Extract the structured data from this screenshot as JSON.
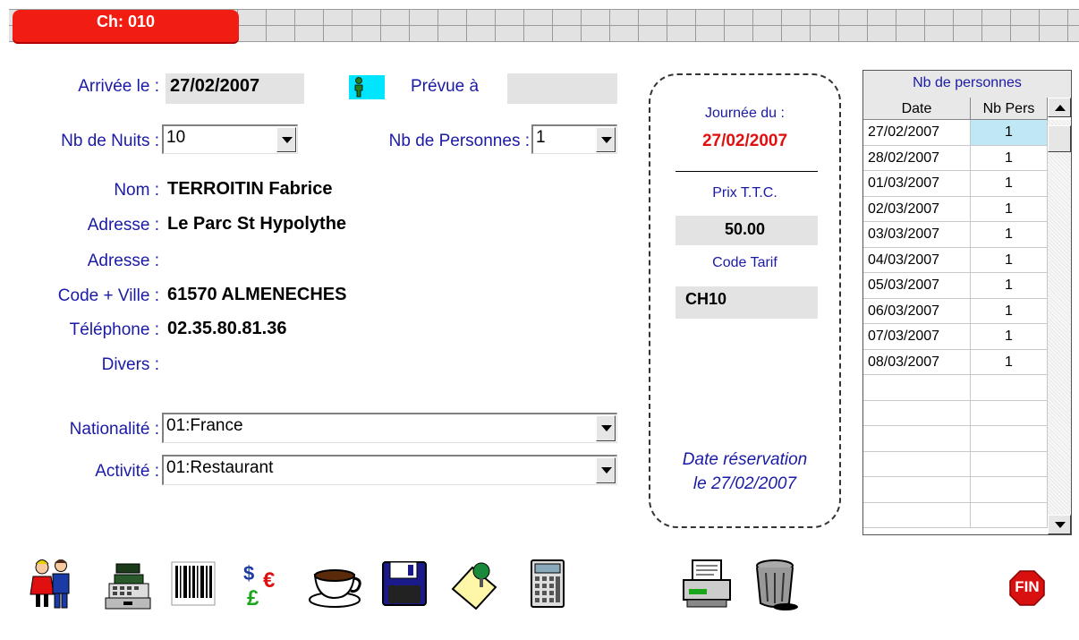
{
  "tab": {
    "label": "Ch: 010"
  },
  "form": {
    "arrivee_label": "Arrivée le :",
    "arrivee_value": "27/02/2007",
    "prevue_label": "Prévue à",
    "prevue_value": "",
    "nuits_label": "Nb de Nuits :",
    "nuits_value": "10",
    "personnes_label": "Nb de Personnes :",
    "personnes_value": "1",
    "nom_label": "Nom :",
    "nom_value": "TERROITIN Fabrice",
    "adresse1_label": "Adresse :",
    "adresse1_value": "Le Parc St Hypolythe",
    "adresse2_label": "Adresse :",
    "adresse2_value": "",
    "ville_label": "Code + Ville :",
    "ville_value": "61570 ALMENECHES",
    "tel_label": "Téléphone :",
    "tel_value": "02.35.80.81.36",
    "divers_label": "Divers :",
    "divers_value": "",
    "nationalite_label": "Nationalité :",
    "nationalite_value": "01:France",
    "activite_label": "Activité :",
    "activite_value": "01:Restaurant"
  },
  "day_panel": {
    "journee_label": "Journée du :",
    "journee_date": "27/02/2007",
    "prix_label": "Prix T.T.C.",
    "prix_value": "50.00",
    "code_label": "Code Tarif",
    "code_value": "CH10",
    "reservation_line1": "Date réservation",
    "reservation_line2": "le 27/02/2007"
  },
  "grid": {
    "title": "Nb de personnes",
    "col_date": "Date",
    "col_pers": "Nb Pers",
    "rows": [
      {
        "date": "27/02/2007",
        "pers": "1"
      },
      {
        "date": "28/02/2007",
        "pers": "1"
      },
      {
        "date": "01/03/2007",
        "pers": "1"
      },
      {
        "date": "02/03/2007",
        "pers": "1"
      },
      {
        "date": "03/03/2007",
        "pers": "1"
      },
      {
        "date": "04/03/2007",
        "pers": "1"
      },
      {
        "date": "05/03/2007",
        "pers": "1"
      },
      {
        "date": "06/03/2007",
        "pers": "1"
      },
      {
        "date": "07/03/2007",
        "pers": "1"
      },
      {
        "date": "08/03/2007",
        "pers": "1"
      }
    ]
  },
  "toolbar": {
    "icons": [
      "clients-icon",
      "cash-register-icon",
      "barcode-icon",
      "currency-icon",
      "coffee-cup-icon",
      "save-disk-icon",
      "note-pin-icon",
      "calculator-icon",
      "printer-icon",
      "trash-icon"
    ],
    "fin_label": "FIN"
  },
  "colors": {
    "label_blue": "#1a1aa6",
    "tab_red": "#f21d12",
    "date_red": "#e01010",
    "selected_cell": "#bfe8f4",
    "person_icon_bg": "#00e5ff"
  }
}
